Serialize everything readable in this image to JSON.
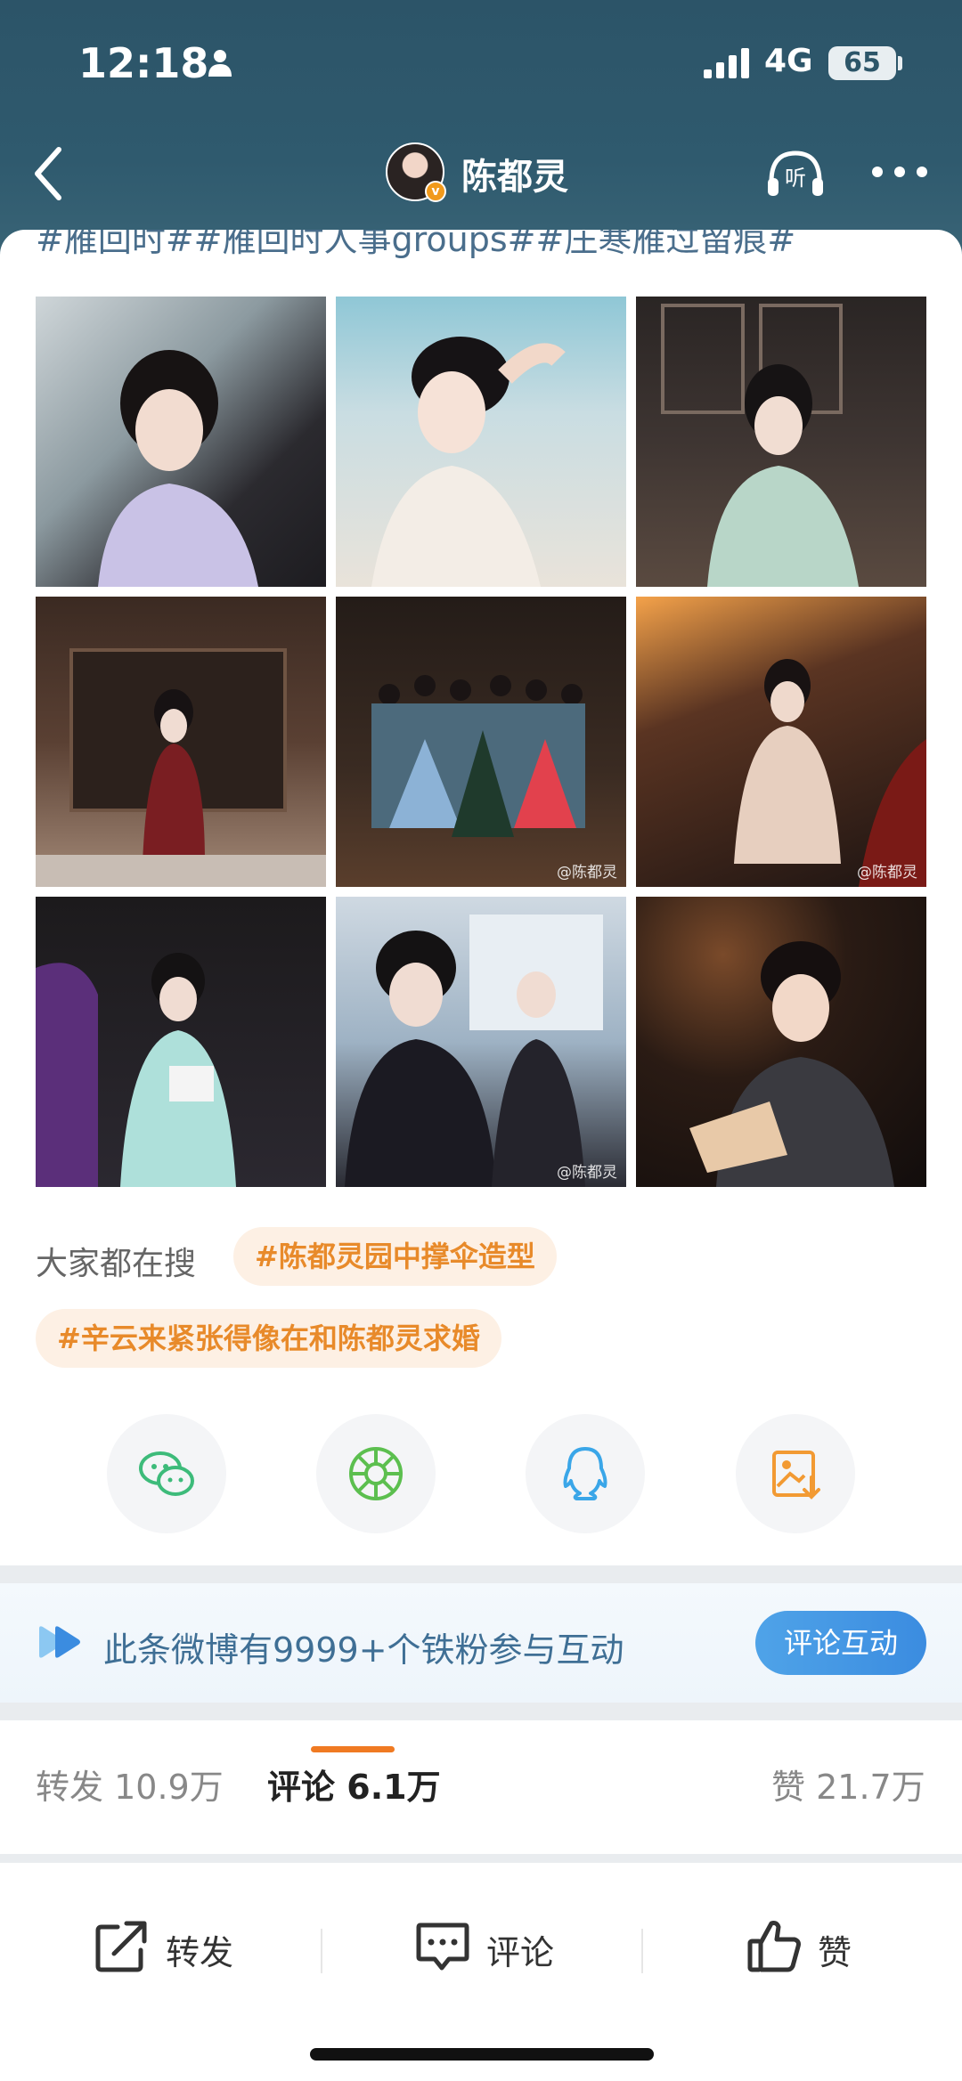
{
  "status_bar": {
    "time": "12:18",
    "network": "4G",
    "battery": "65"
  },
  "nav": {
    "title": "陈都灵",
    "listen_label": "听"
  },
  "post": {
    "hashtags": "#雁回时##雁回时人事groups##庄寒雁过留痕#",
    "photos": [
      {
        "name": "photo-1",
        "watermark": ""
      },
      {
        "name": "photo-2",
        "watermark": ""
      },
      {
        "name": "photo-3",
        "watermark": ""
      },
      {
        "name": "photo-4",
        "watermark": ""
      },
      {
        "name": "photo-5",
        "watermark": "@陈都灵"
      },
      {
        "name": "photo-6",
        "watermark": "@陈都灵"
      },
      {
        "name": "photo-7",
        "watermark": ""
      },
      {
        "name": "photo-8",
        "watermark": "@陈都灵"
      },
      {
        "name": "photo-9",
        "watermark": ""
      }
    ]
  },
  "search": {
    "label": "大家都在搜",
    "chips": [
      "#陈都灵园中撑伞造型",
      "#辛云来紧张得像在和陈都灵求婚"
    ]
  },
  "share": [
    "wechat-icon",
    "moments-icon",
    "qq-icon",
    "save-image-icon"
  ],
  "banner": {
    "text": "此条微博有9999+个铁粉参与互动",
    "button": "评论互动"
  },
  "stats": {
    "repost_label": "转发",
    "repost_count": "10.9万",
    "comment_label": "评论",
    "comment_count": "6.1万",
    "like_label": "赞",
    "like_count": "21.7万"
  },
  "actions": {
    "repost": "转发",
    "comment": "评论",
    "like": "赞"
  },
  "colors": {
    "header": "#2c5468",
    "accent": "#f07a22",
    "chip_text": "#e88a2a",
    "link": "#4a6e8c"
  }
}
